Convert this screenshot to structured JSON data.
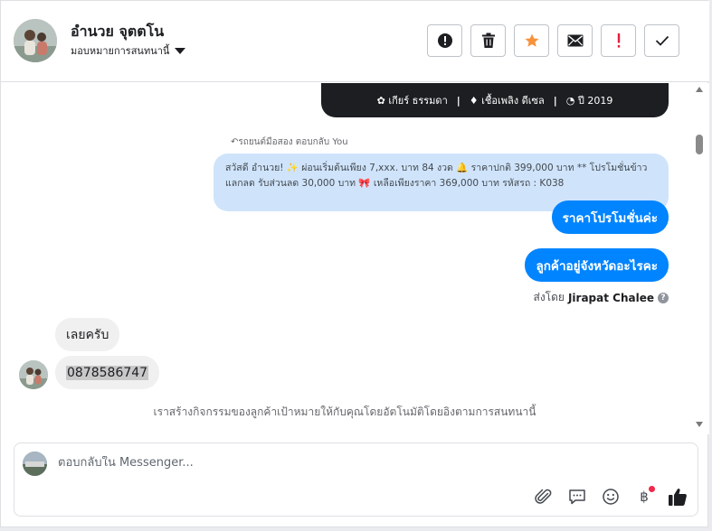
{
  "header": {
    "contact_name": "อำนวย จุตตโน",
    "assign_label": "มอบหมายการสนทนานี้"
  },
  "actions": [
    {
      "name": "report-button",
      "icon": "exclamation-circle-icon"
    },
    {
      "name": "delete-button",
      "icon": "trash-icon"
    },
    {
      "name": "star-button",
      "icon": "star-icon",
      "color": "#f7923b"
    },
    {
      "name": "mark-unread-button",
      "icon": "envelope-icon"
    },
    {
      "name": "follow-up-button",
      "icon": "exclamation-icon",
      "color": "#e41e3f"
    },
    {
      "name": "mark-done-button",
      "icon": "checkmark-icon"
    }
  ],
  "spec_card": {
    "gear": "เกียร์ ธรรมดา",
    "fuel": "เชื้อเพลิง ดีเซล",
    "year": "ปี 2019"
  },
  "conversation": {
    "reply_note": "รถยนต์มือสอง ตอบกลับ You",
    "quoted_text": "สวัสดี อำนวย! ✨ ผ่อนเริ่มต้นเพียง 7,xxx. บาท 84 งวด 🔔 ราคาปกติ 399,000 บาท ** โปรโมชั่นข้าวแลกลด รับส่วนลด 30,000 บาท 🎀 เหลือเพียงราคา 369,000 บาท รหัสรถ : K038",
    "outgoing": [
      "ราคาโปรโมชั่นค่ะ",
      "ลูกค้าอยู่จังหวัดอะไรคะ"
    ],
    "sent_by_prefix": "ส่งโดย",
    "sent_by_name": "Jirapat Chalee",
    "incoming": [
      "เลยครับ",
      "0878586747"
    ],
    "auto_note": "เราสร้างกิจกรรมของลูกค้าเป้าหมายให้กับคุณโดยอัตโนมัติโดยอิงตามการสนทนานี้"
  },
  "composer": {
    "placeholder": "ตอบกลับใน Messenger...",
    "baht_symbol": "฿"
  },
  "colors": {
    "brand_blue": "#0084ff",
    "quoted_bg": "#cfe4fb",
    "incoming_bg": "#f1f0f0"
  }
}
